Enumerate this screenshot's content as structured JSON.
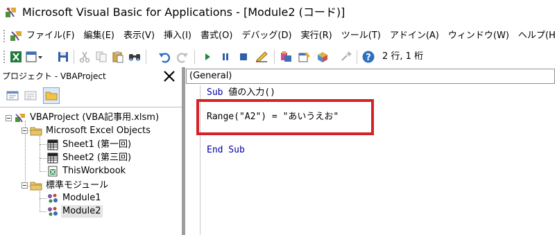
{
  "window": {
    "title": "Microsoft Visual Basic for Applications - [Module2 (コード)]"
  },
  "menu": {
    "items": [
      "ファイル(F)",
      "編集(E)",
      "表示(V)",
      "挿入(I)",
      "書式(O)",
      "デバッグ(D)",
      "実行(R)",
      "ツール(T)",
      "アドイン(A)",
      "ウィンドウ(W)",
      "ヘルプ(H)"
    ]
  },
  "toolbar": {
    "position": "2 行, 1 桁",
    "icons": [
      "excel-view-icon",
      "insert-module-icon",
      "save-icon",
      "cut-icon",
      "copy-icon",
      "paste-icon",
      "find-icon",
      "undo-icon",
      "redo-icon",
      "run-icon",
      "break-icon",
      "reset-icon",
      "design-mode-icon",
      "project-explorer-icon",
      "properties-icon",
      "object-browser-icon",
      "toolbox-icon",
      "help-icon"
    ]
  },
  "project_explorer": {
    "title": "プロジェクト - VBAProject",
    "tree": {
      "root": "VBAProject (VBA記事用.xlsm)",
      "folder_objects": "Microsoft Excel Objects",
      "sheet1": "Sheet1 (第一回)",
      "sheet2": "Sheet2 (第三回)",
      "workbook": "ThisWorkbook",
      "folder_modules": "標準モジュール",
      "module1": "Module1",
      "module2": "Module2"
    }
  },
  "code_window": {
    "object_combo": "(General)",
    "line1_kw": "Sub",
    "line1_rest": " 値の入力()",
    "line2": "Range(\"A2\") = \"あいうえお\"",
    "line3": "End Sub"
  },
  "colors": {
    "highlight_border": "#d52128",
    "keyword": "#0000a0"
  }
}
